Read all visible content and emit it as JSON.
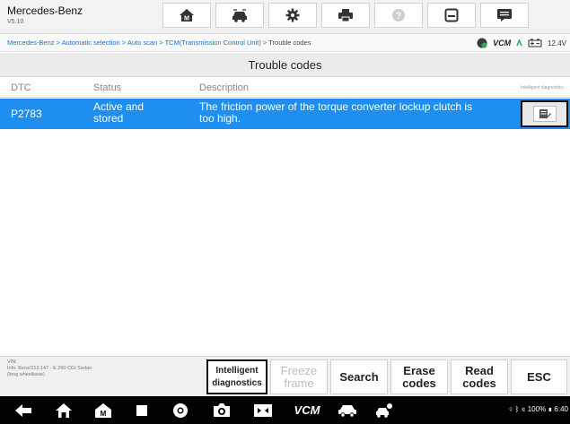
{
  "app": {
    "name": "Mercedes-Benz",
    "version": "V5.10"
  },
  "toolbar": {
    "icons": [
      "home-icon",
      "vehicle-swap-icon",
      "settings-icon",
      "print-icon",
      "help-icon",
      "save-icon",
      "message-icon"
    ]
  },
  "breadcrumb": {
    "path": "Mercedes-Benz > Automatic selection > Auto scan > TCM(Transmission Control Unit) > ",
    "current": "Trouble codes"
  },
  "status": {
    "vcm_label": "VCM",
    "voltage": "12.4V"
  },
  "page_title": "Trouble codes",
  "table": {
    "columns": [
      "DTC",
      "Status",
      "Description",
      "Intelligent diagnostics"
    ],
    "rows": [
      {
        "dtc": "P2783",
        "status_line1": "Active and",
        "status_line2": "stored",
        "desc_line1": "The friction power of the torque converter lockup clutch is",
        "desc_line2": "too high."
      }
    ]
  },
  "vehicle_info": {
    "vin": "VIN:",
    "info": "Info: Benz/212.147 - E 260 CGI Sedan",
    "extra": "(long wheelbase)"
  },
  "buttons": {
    "intelligent_1": "Intelligent",
    "intelligent_2": "diagnostics",
    "freeze_1": "Freeze",
    "freeze_2": "frame",
    "search": "Search",
    "erase_1": "Erase",
    "erase_2": "codes",
    "read_1": "Read",
    "read_2": "codes",
    "esc": "ESC"
  },
  "system": {
    "vcm_label": "VCM",
    "status_text": "100% ▮ 6:40"
  },
  "colors": {
    "accent": "#1e8ef0",
    "navbar": "#000000"
  }
}
